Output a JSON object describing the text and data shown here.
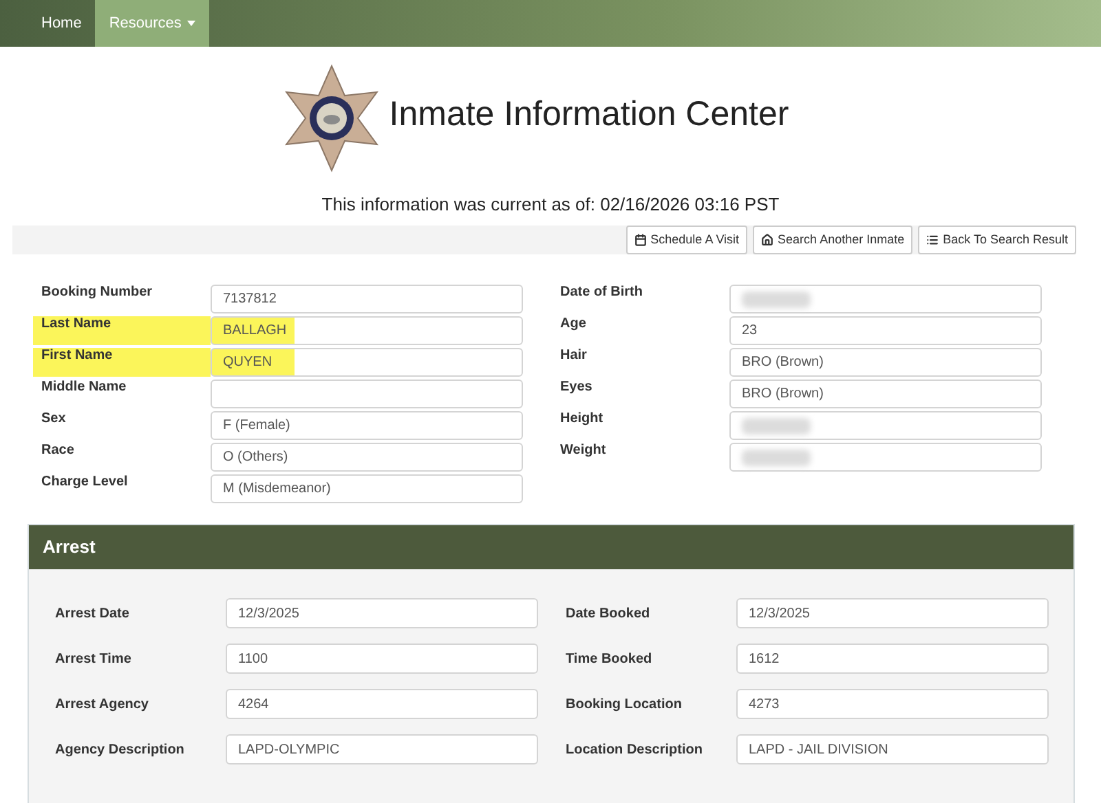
{
  "nav": [
    {
      "label": "Home",
      "selected": false,
      "dropdown": false
    },
    {
      "label": "Resources",
      "selected": true,
      "dropdown": true
    }
  ],
  "title": "Inmate Information Center",
  "current_as_of": "This information was current as of: 02/16/2026 03:16 PST",
  "toolbar": [
    {
      "label": "Schedule A Visit",
      "kind": "calendar"
    },
    {
      "label": "Search Another Inmate",
      "kind": "home"
    },
    {
      "label": "Back To Search Result",
      "kind": "list"
    }
  ],
  "details_left": [
    {
      "label": "Booking Number",
      "value": "7137812",
      "highlighted": false,
      "redacted": false
    },
    {
      "label": "Last Name",
      "value": "BALLAGH",
      "highlighted": true,
      "redacted": false
    },
    {
      "label": "First Name",
      "value": "QUYEN",
      "highlighted": true,
      "redacted": false
    },
    {
      "label": "Middle Name",
      "highlighted": false,
      "redacted": false
    },
    {
      "label": "Sex",
      "value": "F (Female)",
      "highlighted": false,
      "redacted": false
    },
    {
      "label": "Race",
      "value": "O (Others)",
      "highlighted": false,
      "redacted": false
    },
    {
      "label": "Charge Level",
      "value": "M (Misdemeanor)",
      "highlighted": false,
      "redacted": false
    }
  ],
  "details_right": [
    {
      "label": "Date of Birth",
      "highlighted": false,
      "redacted": true
    },
    {
      "label": "Age",
      "value": "23",
      "highlighted": false,
      "redacted": false
    },
    {
      "label": "Hair",
      "value": "BRO (Brown)",
      "highlighted": false,
      "redacted": false
    },
    {
      "label": "Eyes",
      "value": "BRO (Brown)",
      "highlighted": false,
      "redacted": false
    },
    {
      "label": "Height",
      "highlighted": false,
      "redacted": true
    },
    {
      "label": "Weight",
      "highlighted": false,
      "redacted": true
    }
  ],
  "arrest": {
    "title": "Arrest",
    "rows": [
      [
        {
          "label": "Arrest Date",
          "value": "12/3/2025"
        },
        {
          "label": "Date Booked",
          "value": "12/3/2025"
        }
      ],
      [
        {
          "label": "Arrest Time",
          "value": "1100"
        },
        {
          "label": "Time Booked",
          "value": "1612"
        }
      ],
      [
        {
          "label": "Arrest Agency",
          "value": "4264"
        },
        {
          "label": "Booking Location",
          "value": "4273"
        }
      ],
      [
        {
          "label": "Agency Description",
          "value": "LAPD-OLYMPIC"
        },
        {
          "label": "Location Description",
          "value": "LAPD - JAIL DIVISION"
        }
      ]
    ]
  }
}
